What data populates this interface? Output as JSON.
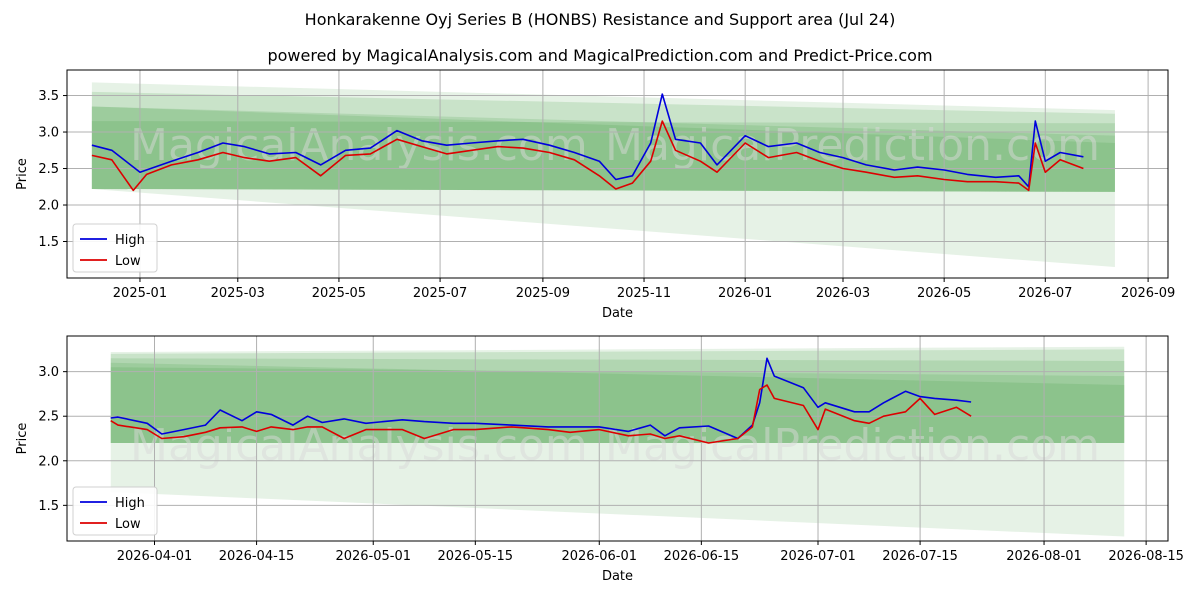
{
  "title": "Honkarakenne Oyj Series B (HONBS) Resistance and Support area (Jul 24)",
  "subtitle": "powered by MagicalAnalysis.com and MagicalPrediction.com and Predict-Price.com",
  "watermarks": [
    "MagicalAnalysis.com",
    "MagicalPrediction.com"
  ],
  "colors": {
    "high": "#0000dd",
    "low": "#dd0000",
    "band": "#3a9a3a",
    "grid": "#b0b0b0"
  },
  "chart_data": [
    {
      "type": "line",
      "xlabel": "Date",
      "ylabel": "Price",
      "ylim": [
        1.0,
        3.85
      ],
      "xlim": [
        "2024-11-18",
        "2026-09-13"
      ],
      "yticks": [
        1.5,
        2.0,
        2.5,
        3.0,
        3.5
      ],
      "xticks": [
        "2025-01",
        "2025-03",
        "2025-05",
        "2025-07",
        "2025-09",
        "2025-11",
        "2026-01",
        "2026-03",
        "2026-05",
        "2026-07",
        "2026-09"
      ],
      "legend": "bottom-left",
      "grid": true,
      "bands": [
        {
          "start": "2024-12-03",
          "end": "2026-08-12",
          "upper": [
            3.68,
            3.3
          ],
          "lower": [
            2.22,
            1.15
          ]
        },
        {
          "start": "2024-12-03",
          "end": "2026-08-12",
          "upper": [
            3.55,
            3.25
          ],
          "lower": [
            2.22,
            2.18
          ]
        },
        {
          "start": "2024-12-03",
          "end": "2026-08-12",
          "upper": [
            3.35,
            2.95
          ],
          "lower": [
            2.22,
            2.18
          ]
        },
        {
          "start": "2024-12-03",
          "end": "2026-08-12",
          "upper": [
            3.15,
            3.12
          ],
          "lower": [
            2.22,
            2.18
          ]
        },
        {
          "start": "2024-12-03",
          "end": "2026-08-12",
          "upper": [
            3.35,
            2.85
          ],
          "lower": [
            2.22,
            2.18
          ]
        }
      ],
      "series": [
        {
          "name": "High",
          "x": [
            "2024-12-03",
            "2024-12-15",
            "2025-01-01",
            "2025-01-20",
            "2025-02-05",
            "2025-02-20",
            "2025-03-05",
            "2025-03-20",
            "2025-04-05",
            "2025-04-20",
            "2025-05-05",
            "2025-05-20",
            "2025-06-05",
            "2025-06-20",
            "2025-07-05",
            "2025-07-20",
            "2025-08-05",
            "2025-08-20",
            "2025-09-05",
            "2025-09-20",
            "2025-10-05",
            "2025-10-15",
            "2025-10-25",
            "2025-11-05",
            "2025-11-12",
            "2025-11-20",
            "2025-12-05",
            "2025-12-15",
            "2026-01-01",
            "2026-01-15",
            "2026-02-01",
            "2026-02-15",
            "2026-03-01",
            "2026-03-15",
            "2026-04-01",
            "2026-04-15",
            "2026-05-01",
            "2026-05-15",
            "2026-06-01",
            "2026-06-15",
            "2026-06-21",
            "2026-06-25",
            "2026-07-01",
            "2026-07-10",
            "2026-07-24"
          ],
          "values": [
            2.82,
            2.75,
            2.45,
            2.6,
            2.72,
            2.85,
            2.8,
            2.7,
            2.72,
            2.55,
            2.75,
            2.78,
            3.02,
            2.88,
            2.82,
            2.85,
            2.88,
            2.9,
            2.82,
            2.72,
            2.6,
            2.35,
            2.4,
            2.85,
            3.52,
            2.9,
            2.85,
            2.55,
            2.95,
            2.8,
            2.85,
            2.72,
            2.65,
            2.55,
            2.48,
            2.52,
            2.48,
            2.42,
            2.38,
            2.4,
            2.25,
            3.15,
            2.6,
            2.72,
            2.66
          ]
        },
        {
          "name": "Low",
          "x": [
            "2024-12-03",
            "2024-12-15",
            "2024-12-28",
            "2025-01-05",
            "2025-01-20",
            "2025-02-05",
            "2025-02-20",
            "2025-03-05",
            "2025-03-20",
            "2025-04-05",
            "2025-04-20",
            "2025-05-05",
            "2025-05-20",
            "2025-06-05",
            "2025-06-20",
            "2025-07-05",
            "2025-07-20",
            "2025-08-05",
            "2025-08-20",
            "2025-09-05",
            "2025-09-20",
            "2025-10-05",
            "2025-10-15",
            "2025-10-25",
            "2025-11-05",
            "2025-11-12",
            "2025-11-20",
            "2025-12-05",
            "2025-12-15",
            "2026-01-01",
            "2026-01-15",
            "2026-02-01",
            "2026-02-15",
            "2026-03-01",
            "2026-03-15",
            "2026-04-01",
            "2026-04-15",
            "2026-05-01",
            "2026-05-15",
            "2026-06-01",
            "2026-06-15",
            "2026-06-21",
            "2026-06-25",
            "2026-07-01",
            "2026-07-10",
            "2026-07-24"
          ],
          "values": [
            2.68,
            2.62,
            2.2,
            2.42,
            2.55,
            2.62,
            2.72,
            2.65,
            2.6,
            2.65,
            2.4,
            2.68,
            2.7,
            2.9,
            2.8,
            2.7,
            2.75,
            2.8,
            2.78,
            2.72,
            2.62,
            2.4,
            2.22,
            2.3,
            2.6,
            3.15,
            2.75,
            2.6,
            2.45,
            2.85,
            2.65,
            2.72,
            2.6,
            2.5,
            2.45,
            2.38,
            2.4,
            2.35,
            2.32,
            2.32,
            2.3,
            2.2,
            2.85,
            2.45,
            2.62,
            2.5
          ]
        }
      ]
    },
    {
      "type": "line",
      "xlabel": "Date",
      "ylabel": "Price",
      "ylim": [
        1.1,
        3.4
      ],
      "xlim": [
        "2026-03-20",
        "2026-08-18"
      ],
      "yticks": [
        1.5,
        2.0,
        2.5,
        3.0
      ],
      "xticks": [
        "2026-04-01",
        "2026-04-15",
        "2026-05-01",
        "2026-05-15",
        "2026-06-01",
        "2026-06-15",
        "2026-07-01",
        "2026-07-15",
        "2026-08-01",
        "2026-08-15"
      ],
      "legend": "bottom-left",
      "grid": true,
      "bands": [
        {
          "start": "2026-03-26",
          "end": "2026-08-12",
          "upper": [
            3.22,
            3.28
          ],
          "lower": [
            1.65,
            1.15
          ]
        },
        {
          "start": "2026-03-26",
          "end": "2026-08-12",
          "upper": [
            3.2,
            3.25
          ],
          "lower": [
            2.2,
            2.2
          ]
        },
        {
          "start": "2026-03-26",
          "end": "2026-08-12",
          "upper": [
            3.05,
            2.95
          ],
          "lower": [
            2.2,
            2.2
          ]
        },
        {
          "start": "2026-03-26",
          "end": "2026-08-12",
          "upper": [
            3.15,
            3.12
          ],
          "lower": [
            2.2,
            2.2
          ]
        },
        {
          "start": "2026-03-26",
          "end": "2026-08-12",
          "upper": [
            3.1,
            2.85
          ],
          "lower": [
            2.2,
            2.2
          ]
        }
      ],
      "series": [
        {
          "name": "High",
          "x": [
            "2026-03-26",
            "2026-03-27",
            "2026-03-31",
            "2026-04-02",
            "2026-04-05",
            "2026-04-08",
            "2026-04-10",
            "2026-04-13",
            "2026-04-15",
            "2026-04-17",
            "2026-04-20",
            "2026-04-22",
            "2026-04-24",
            "2026-04-27",
            "2026-04-30",
            "2026-05-05",
            "2026-05-08",
            "2026-05-12",
            "2026-05-15",
            "2026-05-20",
            "2026-05-25",
            "2026-05-28",
            "2026-06-01",
            "2026-06-05",
            "2026-06-08",
            "2026-06-10",
            "2026-06-12",
            "2026-06-16",
            "2026-06-20",
            "2026-06-22",
            "2026-06-23",
            "2026-06-24",
            "2026-06-25",
            "2026-06-29",
            "2026-07-01",
            "2026-07-02",
            "2026-07-06",
            "2026-07-08",
            "2026-07-10",
            "2026-07-13",
            "2026-07-15",
            "2026-07-17",
            "2026-07-20",
            "2026-07-22"
          ],
          "values": [
            2.48,
            2.49,
            2.42,
            2.3,
            2.35,
            2.4,
            2.57,
            2.45,
            2.55,
            2.52,
            2.4,
            2.5,
            2.43,
            2.47,
            2.42,
            2.46,
            2.44,
            2.42,
            2.42,
            2.4,
            2.38,
            2.38,
            2.38,
            2.33,
            2.4,
            2.28,
            2.37,
            2.39,
            2.25,
            2.4,
            2.65,
            3.15,
            2.95,
            2.82,
            2.6,
            2.65,
            2.55,
            2.55,
            2.65,
            2.78,
            2.72,
            2.7,
            2.68,
            2.66
          ]
        },
        {
          "name": "Low",
          "x": [
            "2026-03-26",
            "2026-03-27",
            "2026-03-31",
            "2026-04-02",
            "2026-04-05",
            "2026-04-08",
            "2026-04-10",
            "2026-04-13",
            "2026-04-15",
            "2026-04-17",
            "2026-04-20",
            "2026-04-22",
            "2026-04-24",
            "2026-04-27",
            "2026-04-30",
            "2026-05-05",
            "2026-05-08",
            "2026-05-12",
            "2026-05-15",
            "2026-05-20",
            "2026-05-25",
            "2026-05-28",
            "2026-06-01",
            "2026-06-05",
            "2026-06-08",
            "2026-06-10",
            "2026-06-12",
            "2026-06-16",
            "2026-06-20",
            "2026-06-22",
            "2026-06-23",
            "2026-06-24",
            "2026-06-25",
            "2026-06-29",
            "2026-07-01",
            "2026-07-02",
            "2026-07-06",
            "2026-07-08",
            "2026-07-10",
            "2026-07-13",
            "2026-07-15",
            "2026-07-17",
            "2026-07-20",
            "2026-07-22"
          ],
          "values": [
            2.45,
            2.4,
            2.35,
            2.25,
            2.27,
            2.32,
            2.37,
            2.38,
            2.33,
            2.38,
            2.35,
            2.38,
            2.38,
            2.25,
            2.35,
            2.35,
            2.25,
            2.35,
            2.35,
            2.38,
            2.35,
            2.32,
            2.35,
            2.28,
            2.3,
            2.25,
            2.28,
            2.2,
            2.25,
            2.38,
            2.8,
            2.85,
            2.7,
            2.62,
            2.35,
            2.58,
            2.45,
            2.42,
            2.5,
            2.55,
            2.7,
            2.52,
            2.6,
            2.5
          ]
        }
      ]
    }
  ]
}
